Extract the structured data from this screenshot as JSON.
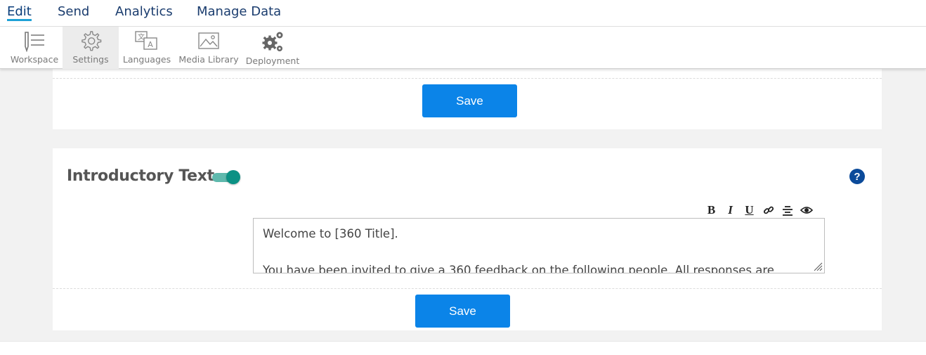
{
  "menu": {
    "items": [
      {
        "label": "Edit",
        "active": true
      },
      {
        "label": "Send"
      },
      {
        "label": "Analytics"
      },
      {
        "label": "Manage Data"
      }
    ]
  },
  "toolbar": {
    "items": [
      {
        "label": "Workspace",
        "icon": "workspace-icon"
      },
      {
        "label": "Settings",
        "icon": "gear-icon",
        "selected": true
      },
      {
        "label": "Languages",
        "icon": "translate-icon"
      },
      {
        "label": "Media Library",
        "icon": "image-icon"
      },
      {
        "label": "Deployment",
        "icon": "gears-icon"
      }
    ]
  },
  "card1": {
    "save_label": "Save"
  },
  "card2": {
    "title": "Introductory Text",
    "toggle_on": true,
    "help_label": "?",
    "editor_tools": [
      "B",
      "I",
      "U"
    ],
    "editor_lines": [
      "Welcome to [360 Title].",
      "",
      "You have been invited to give a 360 feedback on the following people. All responses are"
    ],
    "save_label": "Save"
  },
  "colors": {
    "primary_button": "#0b84e8",
    "toggle_on": "#0b9184",
    "help_icon": "#0b4a9a",
    "menu_text": "#1a3c6e",
    "menu_active_underline": "#1ea1d6"
  }
}
